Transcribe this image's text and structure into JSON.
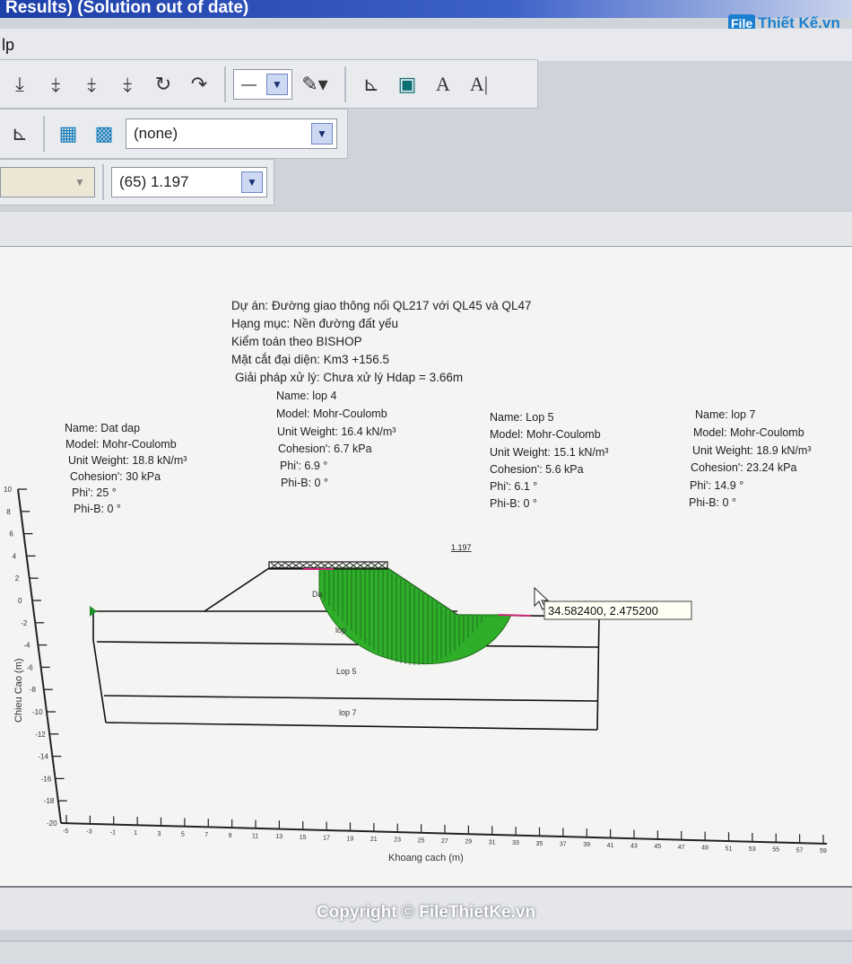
{
  "window": {
    "title": "Results) (Solution out of date)",
    "menu_fragment": "lp",
    "watermark_logo": "FileThietKe.vn"
  },
  "toolbar": {
    "line_style_value": "—",
    "tools": [
      "draw-slip-icon",
      "draw-slip-icon",
      "draw-slip-icon",
      "draw-slip-icon",
      "rotate-icon",
      "redo-icon",
      "line-style-icon",
      "pen-color-icon",
      "axis-icon",
      "graph-icon",
      "text-style-icon",
      "text-icon"
    ]
  },
  "toolbar2": {
    "combo_value": "(none)"
  },
  "toolbar3": {
    "disabled_combo_value": "",
    "slip_combo_value": "(65) 1.197"
  },
  "header": {
    "line1": "Dự án: Đường giao thông nối QL217 với QL45 và QL47",
    "line2": "Hạng mục: Nền đường đất yếu",
    "line3": "Kiểm toán theo BISHOP",
    "line4": "Mặt cắt đại diện: Km3 +156.5",
    "line5": "Giải pháp xử lý: Chưa xử lý Hdap = 3.66m"
  },
  "materials": [
    {
      "name": "Name: Dat dap",
      "model": "Model: Mohr-Coulomb",
      "unit_weight": "Unit Weight: 18.8 kN/m³",
      "cohesion": "Cohesion': 30 kPa",
      "phi": "Phi': 25 °",
      "phib": "Phi-B: 0 °"
    },
    {
      "name": "Name: lop 4",
      "model": "Model: Mohr-Coulomb",
      "unit_weight": "Unit Weight: 16.4 kN/m³",
      "cohesion": "Cohesion': 6.7 kPa",
      "phi": "Phi': 6.9 °",
      "phib": "Phi-B: 0 °"
    },
    {
      "name": "Name: Lop 5",
      "model": "Model: Mohr-Coulomb",
      "unit_weight": "Unit Weight: 15.1 kN/m³",
      "cohesion": "Cohesion': 5.6 kPa",
      "phi": "Phi': 6.1 °",
      "phib": "Phi-B: 0 °"
    },
    {
      "name": "Name: lop 7",
      "model": "Model: Mohr-Coulomb",
      "unit_weight": "Unit Weight: 18.9 kN/m³",
      "cohesion": "Cohesion': 23.24 kPa",
      "phi": "Phi': 14.9 °",
      "phib": "Phi-B: 0 °"
    }
  ],
  "plot": {
    "factor_of_safety": "1.197",
    "cursor_readout": "34.582400, 2.475200",
    "ylabel": "Chieu Cao (m)",
    "xlabel": "Khoang cach (m)",
    "layer_labels": {
      "dat_dap": "Da",
      "lop4": "lop",
      "lop5": "Lop 5",
      "lop7": "lop 7"
    },
    "y_ticks": [
      "10",
      "8",
      "6",
      "4",
      "2",
      "0",
      "-2",
      "-4",
      "-6",
      "-8",
      "-10",
      "-12",
      "-14",
      "-16",
      "-18",
      "-20"
    ],
    "x_ticks": [
      "-5",
      "-3",
      "-1",
      "1",
      "3",
      "5",
      "7",
      "9",
      "11",
      "13",
      "15",
      "17",
      "19",
      "21",
      "23",
      "25",
      "27",
      "29",
      "31",
      "33",
      "35",
      "37",
      "39",
      "41",
      "43",
      "45",
      "47",
      "49",
      "51",
      "53",
      "55",
      "57",
      "59"
    ],
    "slip_fill_color": "#2fae2a"
  },
  "footer": {
    "copyright": "Copyright © FileThietKe.vn"
  }
}
